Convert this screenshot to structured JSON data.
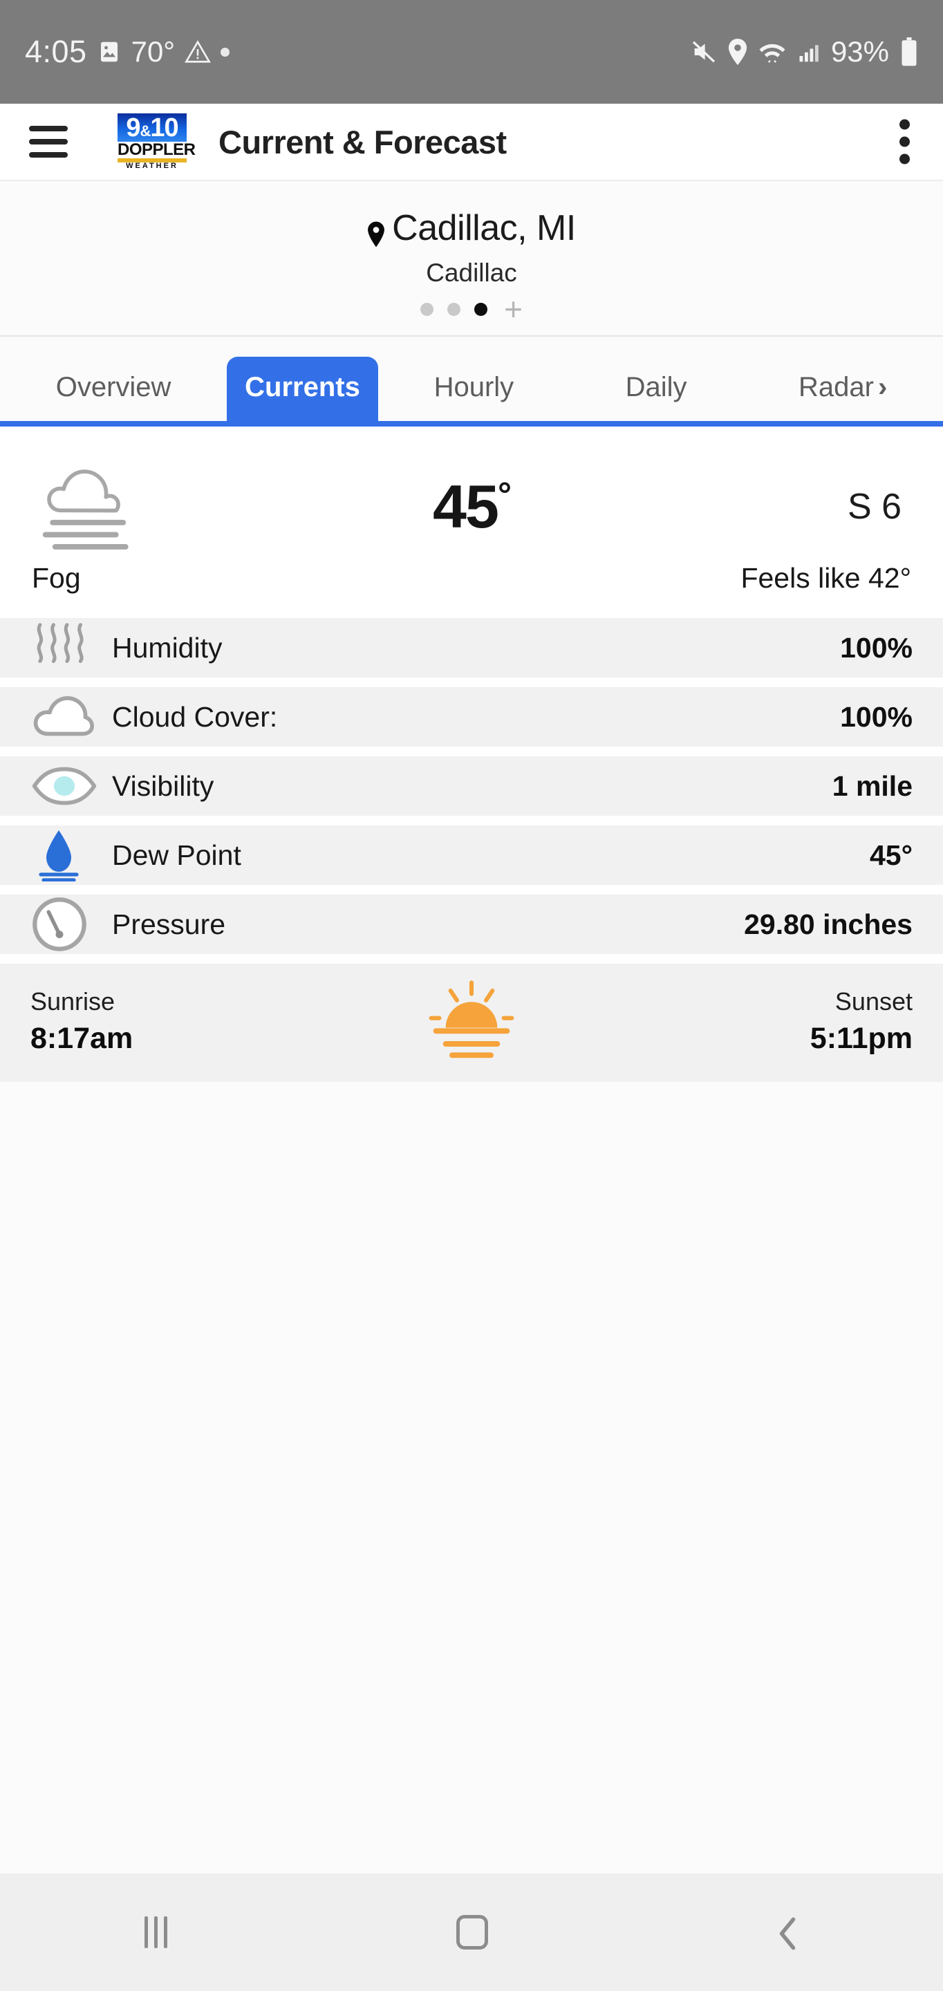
{
  "statusbar": {
    "time": "4:05",
    "temp": "70°",
    "battery_pct": "93%",
    "icons_left": [
      "photo-icon",
      "warning-triangle-icon",
      "dot-icon"
    ],
    "icons_right": [
      "volume-mute-icon",
      "location-pin-icon",
      "wifi-icon",
      "cellular-signal-icon",
      "battery-icon"
    ],
    "bg_color": "#7c7c7c"
  },
  "appbar": {
    "menu_icon": "hamburger-menu-icon",
    "logo": {
      "line1": "9",
      "amp": "&",
      "line1b": "10",
      "line2": "DOPPLER",
      "line3": "WEATHER"
    },
    "title": "Current & Forecast",
    "overflow_icon": "kebab-menu-icon"
  },
  "location": {
    "pin_icon": "map-pin-icon",
    "city": "Cadillac, MI",
    "sublabel": "Cadillac",
    "page_dots": 3,
    "active_dot_index": 2,
    "add_label": "+"
  },
  "tabs": {
    "items": [
      {
        "label": "Overview",
        "active": false
      },
      {
        "label": "Currents",
        "active": true
      },
      {
        "label": "Hourly",
        "active": false
      },
      {
        "label": "Daily",
        "active": false
      },
      {
        "label": "Radar",
        "active": false,
        "chevron": "›"
      }
    ],
    "accent_color": "#3370e8"
  },
  "current": {
    "condition_icon": "fog-icon",
    "temperature": "45",
    "degree": "°",
    "wind": "S 6",
    "condition": "Fog",
    "feels_like": "Feels like 42°"
  },
  "details": [
    {
      "icon": "humidity-waves-icon",
      "label": "Humidity",
      "value": "100%"
    },
    {
      "icon": "cloud-icon",
      "label": "Cloud Cover:",
      "value": "100%"
    },
    {
      "icon": "eye-visibility-icon",
      "label": "Visibility",
      "value": "1 mile"
    },
    {
      "icon": "dew-point-droplet-icon",
      "label": "Dew Point",
      "value": "45°"
    },
    {
      "icon": "pressure-gauge-icon",
      "label": "Pressure",
      "value": "29.80 inches"
    }
  ],
  "sun": {
    "sunrise_label": "Sunrise",
    "sunrise_value": "8:17am",
    "icon": "sunrise-sunset-icon",
    "sunset_label": "Sunset",
    "sunset_value": "5:11pm",
    "icon_color": "#f5a33a"
  },
  "navbar": {
    "recents": "recents-icon",
    "home": "home-icon",
    "back": "back-icon"
  }
}
